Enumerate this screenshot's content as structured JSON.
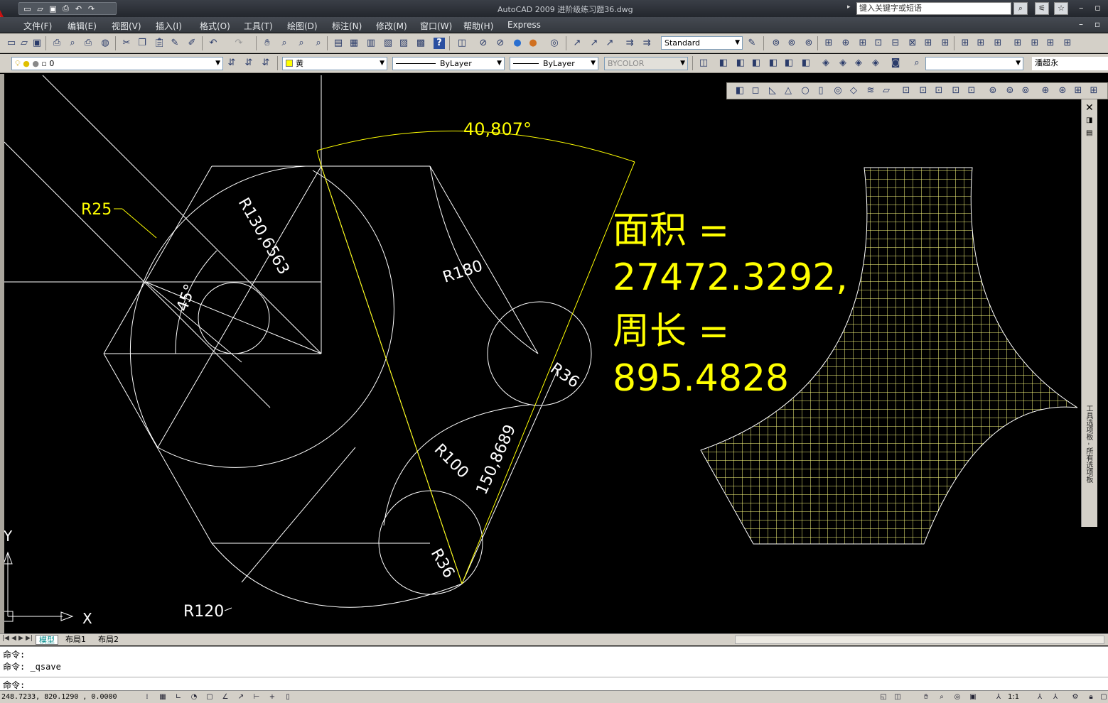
{
  "app": {
    "title": "AutoCAD 2009  进阶级练习题36.dwg",
    "search_placeholder": "键入关键字或短语"
  },
  "menu": [
    "文件(F)",
    "编辑(E)",
    "视图(V)",
    "插入(I)",
    "格式(O)",
    "工具(T)",
    "绘图(D)",
    "标注(N)",
    "修改(M)",
    "窗口(W)",
    "帮助(H)",
    "Express"
  ],
  "toolbar": {
    "text_style": "Standard",
    "layer": "0",
    "color": "黄",
    "linetype": "ByLayer",
    "lineweight": "ByLayer",
    "plotstyle": "BYCOLOR",
    "user_label": "潘超永"
  },
  "drawing": {
    "dims": {
      "angle_top": "40,807°",
      "r25": "R25",
      "r130": "R130,6563",
      "angle45": "45°",
      "r180": "R180",
      "r36_upper": "R36",
      "r100": "R100",
      "len150": "150,8689",
      "r36_lower": "R36",
      "r120": "R120"
    },
    "ucs": {
      "x": "X",
      "y": "Y"
    },
    "result": {
      "line1": "面积 =",
      "line2": "27472.3292,",
      "line3": "周长 =",
      "line4": "895.4828"
    }
  },
  "right_panel_label": "工具选项板 - 所有选项板",
  "tabs": [
    "模型",
    "布局1",
    "布局2"
  ],
  "command": {
    "line1": "命令:",
    "line2": "命令: _qsave",
    "prompt": "命令:"
  },
  "status": {
    "coords": "248.7233, 820.1290 , 0.0000",
    "scale": "1:1"
  },
  "colors": {
    "dimension": "#ffff00",
    "geometry": "#ffffff",
    "background": "#000000"
  }
}
